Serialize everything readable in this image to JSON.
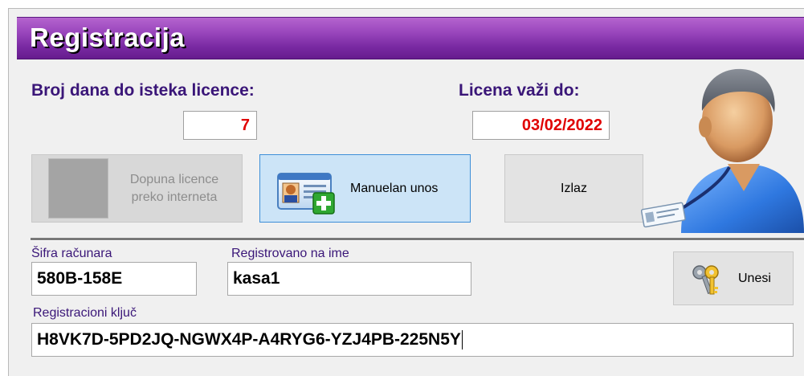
{
  "window": {
    "title": "Registracija"
  },
  "license": {
    "days_label": "Broj dana do isteka licence:",
    "days_value": "7",
    "valid_label": "Licena važi do:",
    "valid_value": "03/02/2022"
  },
  "buttons": {
    "online_renew": "Dopuna licence\npreko interneta",
    "manual_entry": "Manuelan unos",
    "exit": "Izlaz",
    "submit": "Unesi"
  },
  "form": {
    "computer_code_label": "Šifra računara",
    "computer_code_value": "580B-158E",
    "registered_name_label": "Registrovano na ime",
    "registered_name_value": "kasa1",
    "reg_key_label": "Registracioni ključ",
    "reg_key_value": "H8VK7D-5PD2JQ-NGWX4P-A4RYG6-YZJ4PB-225N5Y"
  },
  "icons": {
    "user_avatar": "user-with-badge-icon",
    "manual_entry": "id-card-plus-icon",
    "submit": "keys-icon"
  },
  "colors": {
    "title_bar": "#8a38b0",
    "label_text": "#3a1678",
    "value_text": "#e00000",
    "active_button": "#cce4f7"
  }
}
